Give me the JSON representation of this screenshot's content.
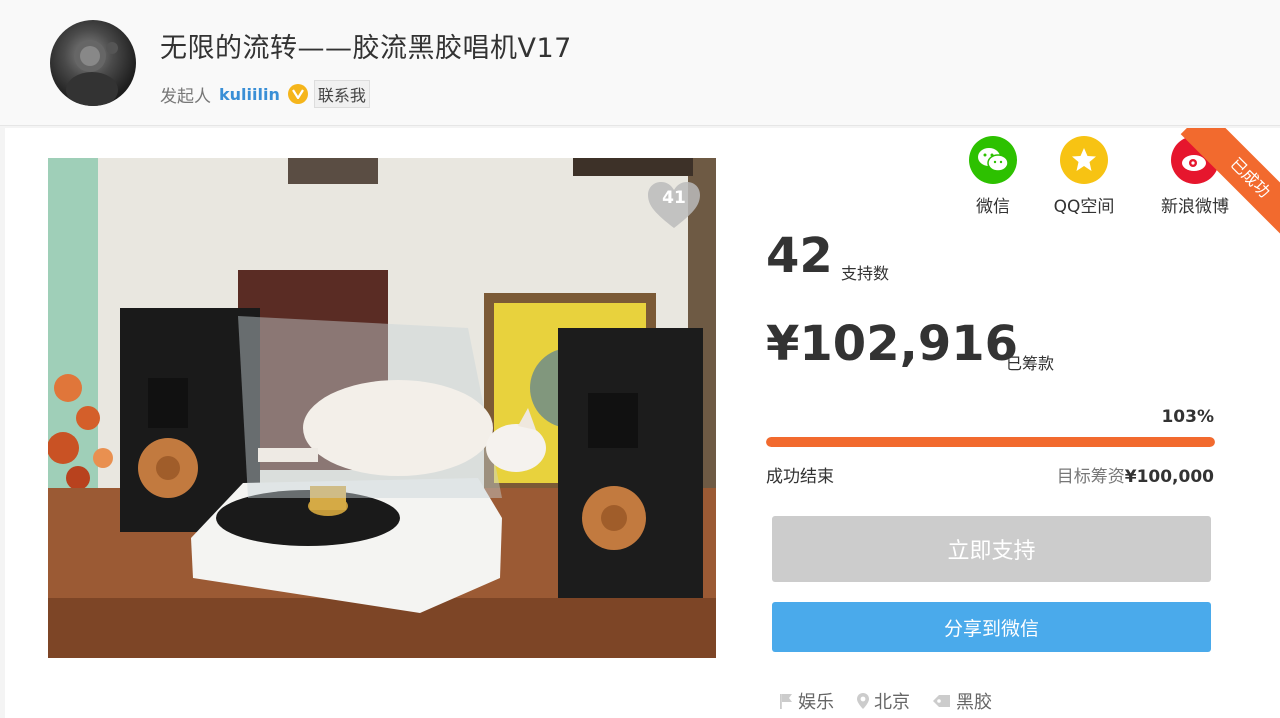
{
  "project": {
    "title": "无限的流转——胶流黑胶唱机V17",
    "initiator_label": "发起人",
    "initiator_name": "kuliilin",
    "contact_label": "联系我"
  },
  "photo": {
    "like_count": "41"
  },
  "share": {
    "items": [
      {
        "label": "微信",
        "icon": "wechat-icon",
        "color": "#2dc100"
      },
      {
        "label": "QQ空间",
        "icon": "qzone-icon",
        "color": "#f7c313"
      },
      {
        "label": "新浪微博",
        "icon": "weibo-icon",
        "color": "#e6162d"
      }
    ]
  },
  "ribbon": {
    "label": "已成功",
    "color": "#f26a2e"
  },
  "stats": {
    "supporters_value": "42",
    "supporters_label": "支持数",
    "raised_value": "¥102,916",
    "raised_label": "已筹款",
    "progress_percent": "103%",
    "progress_fraction": 1.03,
    "status_text": "成功结束",
    "goal_label": "目标筹资",
    "goal_value": "¥100,000"
  },
  "actions": {
    "support_label": "立即支持",
    "share_wechat_label": "分享到微信"
  },
  "tags": [
    {
      "label": "娱乐",
      "icon": "flag-icon"
    },
    {
      "label": "北京",
      "icon": "location-pin-icon"
    },
    {
      "label": "黑胶",
      "icon": "tag-icon"
    }
  ],
  "colors": {
    "accent": "#f26a2e",
    "link": "#3a8fd6",
    "share_button": "#4aaaeb",
    "disabled_button": "#cccccc"
  }
}
